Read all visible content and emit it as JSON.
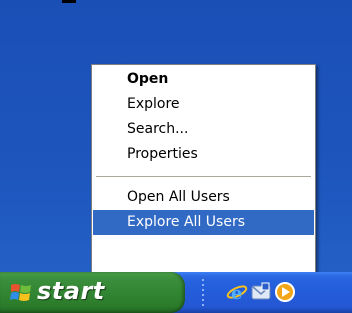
{
  "context_menu": {
    "items": [
      {
        "label": "Open",
        "bold": true,
        "selected": false
      },
      {
        "label": "Explore",
        "bold": false,
        "selected": false
      },
      {
        "label": "Search...",
        "bold": false,
        "selected": false
      },
      {
        "label": "Properties",
        "bold": false,
        "selected": false
      },
      {
        "label": "Open All Users",
        "bold": false,
        "selected": false
      },
      {
        "label": "Explore All Users",
        "bold": false,
        "selected": true
      }
    ]
  },
  "taskbar": {
    "start_label": "start",
    "quick_launch": [
      "internet-explorer-icon",
      "outlook-express-icon",
      "media-player-icon"
    ]
  },
  "colors": {
    "desktop": "#1d52b8",
    "selection": "#316ac5",
    "start_button": "#318431",
    "taskbar": "#245edb"
  }
}
